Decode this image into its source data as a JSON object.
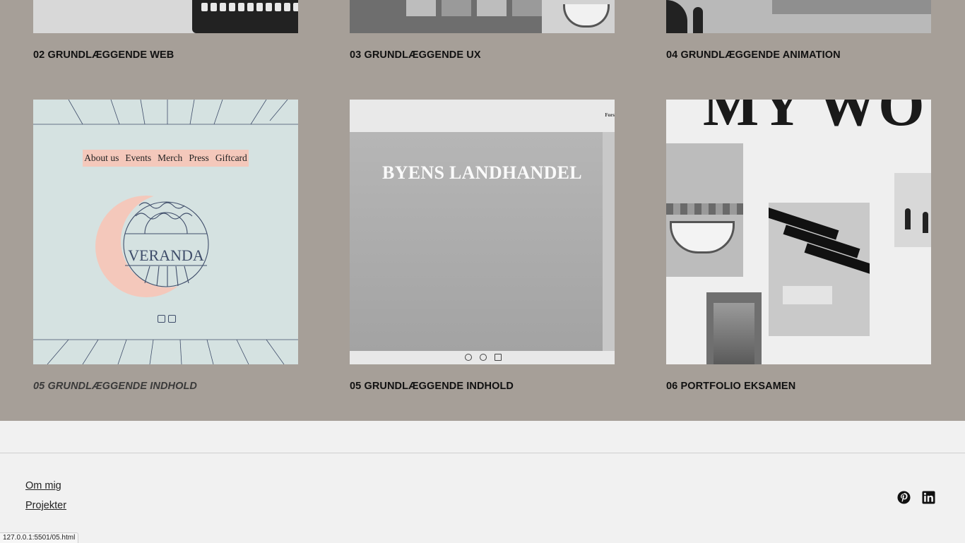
{
  "projects": {
    "items": [
      {
        "title": "02 GRUNDLÆGGENDE WEB"
      },
      {
        "title": "03 GRUNDLÆGGENDE UX"
      },
      {
        "title": "04 GRUNDLÆGGENDE ANIMATION"
      },
      {
        "title": "05 GRUNDLÆGGENDE INDHOLD",
        "hovered": true
      },
      {
        "title": "05 GRUNDLÆGGENDE INDHOLD"
      },
      {
        "title": "06 PORTFOLIO EKSAMEN"
      }
    ],
    "background_color": "#a69f98"
  },
  "veranda_preview": {
    "nav": [
      "About us",
      "Events",
      "Merch",
      "Press",
      "Giftcard"
    ],
    "logo_text": "VERANDA",
    "icons": [
      "instagram-icon",
      "mail-icon"
    ]
  },
  "byens_preview": {
    "top_text": "Fors",
    "heading": "BYENS LANDHANDEL",
    "icons": [
      "instagram-icon",
      "facebook-icon",
      "mail-icon"
    ]
  },
  "portfolio_preview": {
    "heading": "MY WO"
  },
  "footer": {
    "links": [
      "Om mig",
      "Projekter"
    ],
    "social_icons": [
      "pinterest-icon",
      "linkedin-icon"
    ]
  },
  "status_bar": {
    "url": "127.0.0.1:5501/05.html"
  }
}
